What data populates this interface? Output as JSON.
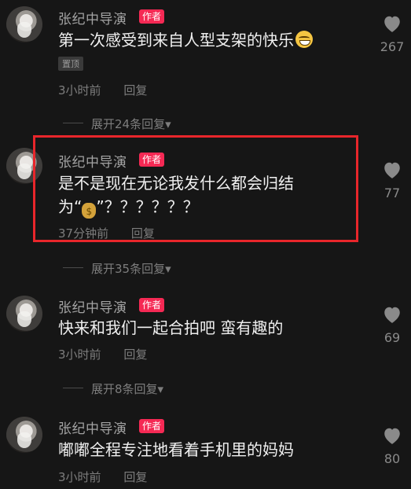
{
  "comments": [
    {
      "author": "张纪中导演",
      "badge": "作者",
      "text_lines": [
        "第一次感受到来自人型支架的快乐"
      ],
      "emoji": "grin-emoji",
      "pinned_label": "置顶",
      "time": "3小时前",
      "reply_label": "回复",
      "likes": "267",
      "expand_label": "展开24条回复▾"
    },
    {
      "author": "张纪中导演",
      "badge": "作者",
      "text_lines": [
        "是不是现在无论我发什么都会归结",
        "为“",
        "”？？？？？？"
      ],
      "emoji": "money-bag-emoji",
      "time": "37分钟前",
      "reply_label": "回复",
      "likes": "77",
      "expand_label": "展开35条回复▾"
    },
    {
      "author": "张纪中导演",
      "badge": "作者",
      "text_lines": [
        "快来和我们一起合拍吧 蛮有趣的"
      ],
      "time": "3小时前",
      "reply_label": "回复",
      "likes": "69",
      "expand_label": "展开8条回复▾"
    },
    {
      "author": "张纪中导演",
      "badge": "作者",
      "text_lines": [
        "嘟嘟全程专注地看着手机里的妈妈"
      ],
      "time": "3小时前",
      "reply_label": "回复",
      "likes": "80"
    }
  ],
  "colors": {
    "background": "#161616",
    "badge": "#f52954",
    "highlight_border": "#e8262b"
  }
}
